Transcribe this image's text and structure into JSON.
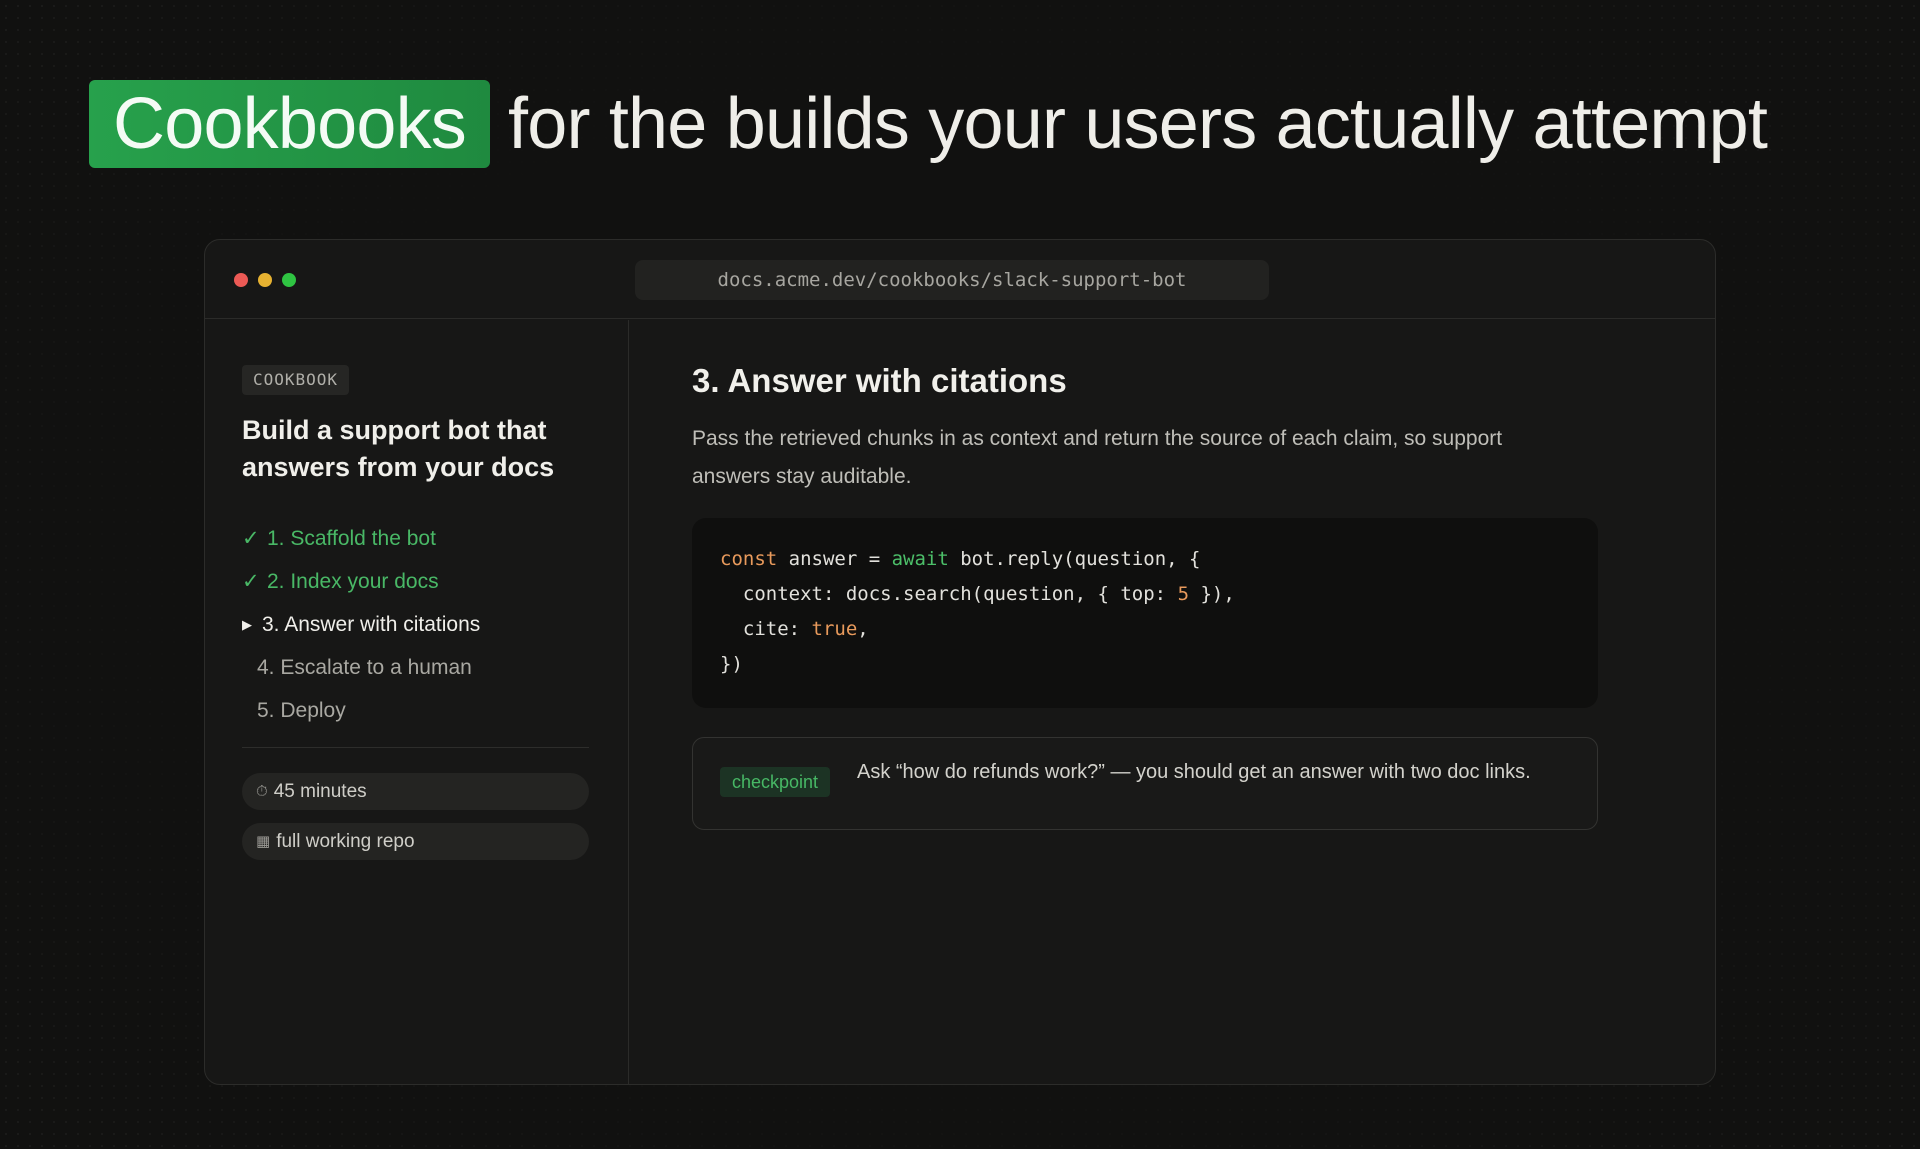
{
  "headline": {
    "highlight": "Cookbooks",
    "rest": "for the builds your users actually attempt"
  },
  "browser": {
    "url": "docs.acme.dev/cookbooks/slack-support-bot"
  },
  "sidebar": {
    "tag": "COOKBOOK",
    "title": "Build a support bot that answers from your docs",
    "steps": [
      {
        "label": "1. Scaffold the bot",
        "status": "done",
        "marker": "✓"
      },
      {
        "label": "2. Index your docs",
        "status": "done",
        "marker": "✓"
      },
      {
        "label": "3. Answer with citations",
        "status": "current",
        "marker": "▶"
      },
      {
        "label": "4. Escalate to a human",
        "status": "todo"
      },
      {
        "label": "5. Deploy",
        "status": "todo"
      }
    ],
    "meta": {
      "duration_icon": "⏱",
      "duration": "45 minutes",
      "repo_icon": "▦",
      "repo": "full working repo"
    }
  },
  "main": {
    "title": "3. Answer with citations",
    "description": "Pass the retrieved chunks in as context and return the source of each claim, so support answers stay auditable.",
    "code": {
      "t1": "const",
      "t2": " answer = ",
      "t3": "await",
      "t4": " bot.reply(question, {",
      "t5": "  context: docs.search(question, { top: ",
      "t6": "5",
      "t7": " }),",
      "t8": "  cite: ",
      "t9": "true",
      "t10": ",",
      "t11": "})"
    },
    "callout": {
      "badge": "checkpoint",
      "text": "Ask “how do refunds work?” — you should get an answer with two doc links."
    }
  },
  "colors": {
    "accent_green": "#27a14c",
    "done_green": "#49b866",
    "code_orange": "#e89a5c",
    "traffic_red": "#ec5a55",
    "traffic_yellow": "#e7b231",
    "traffic_green": "#2fc442"
  }
}
